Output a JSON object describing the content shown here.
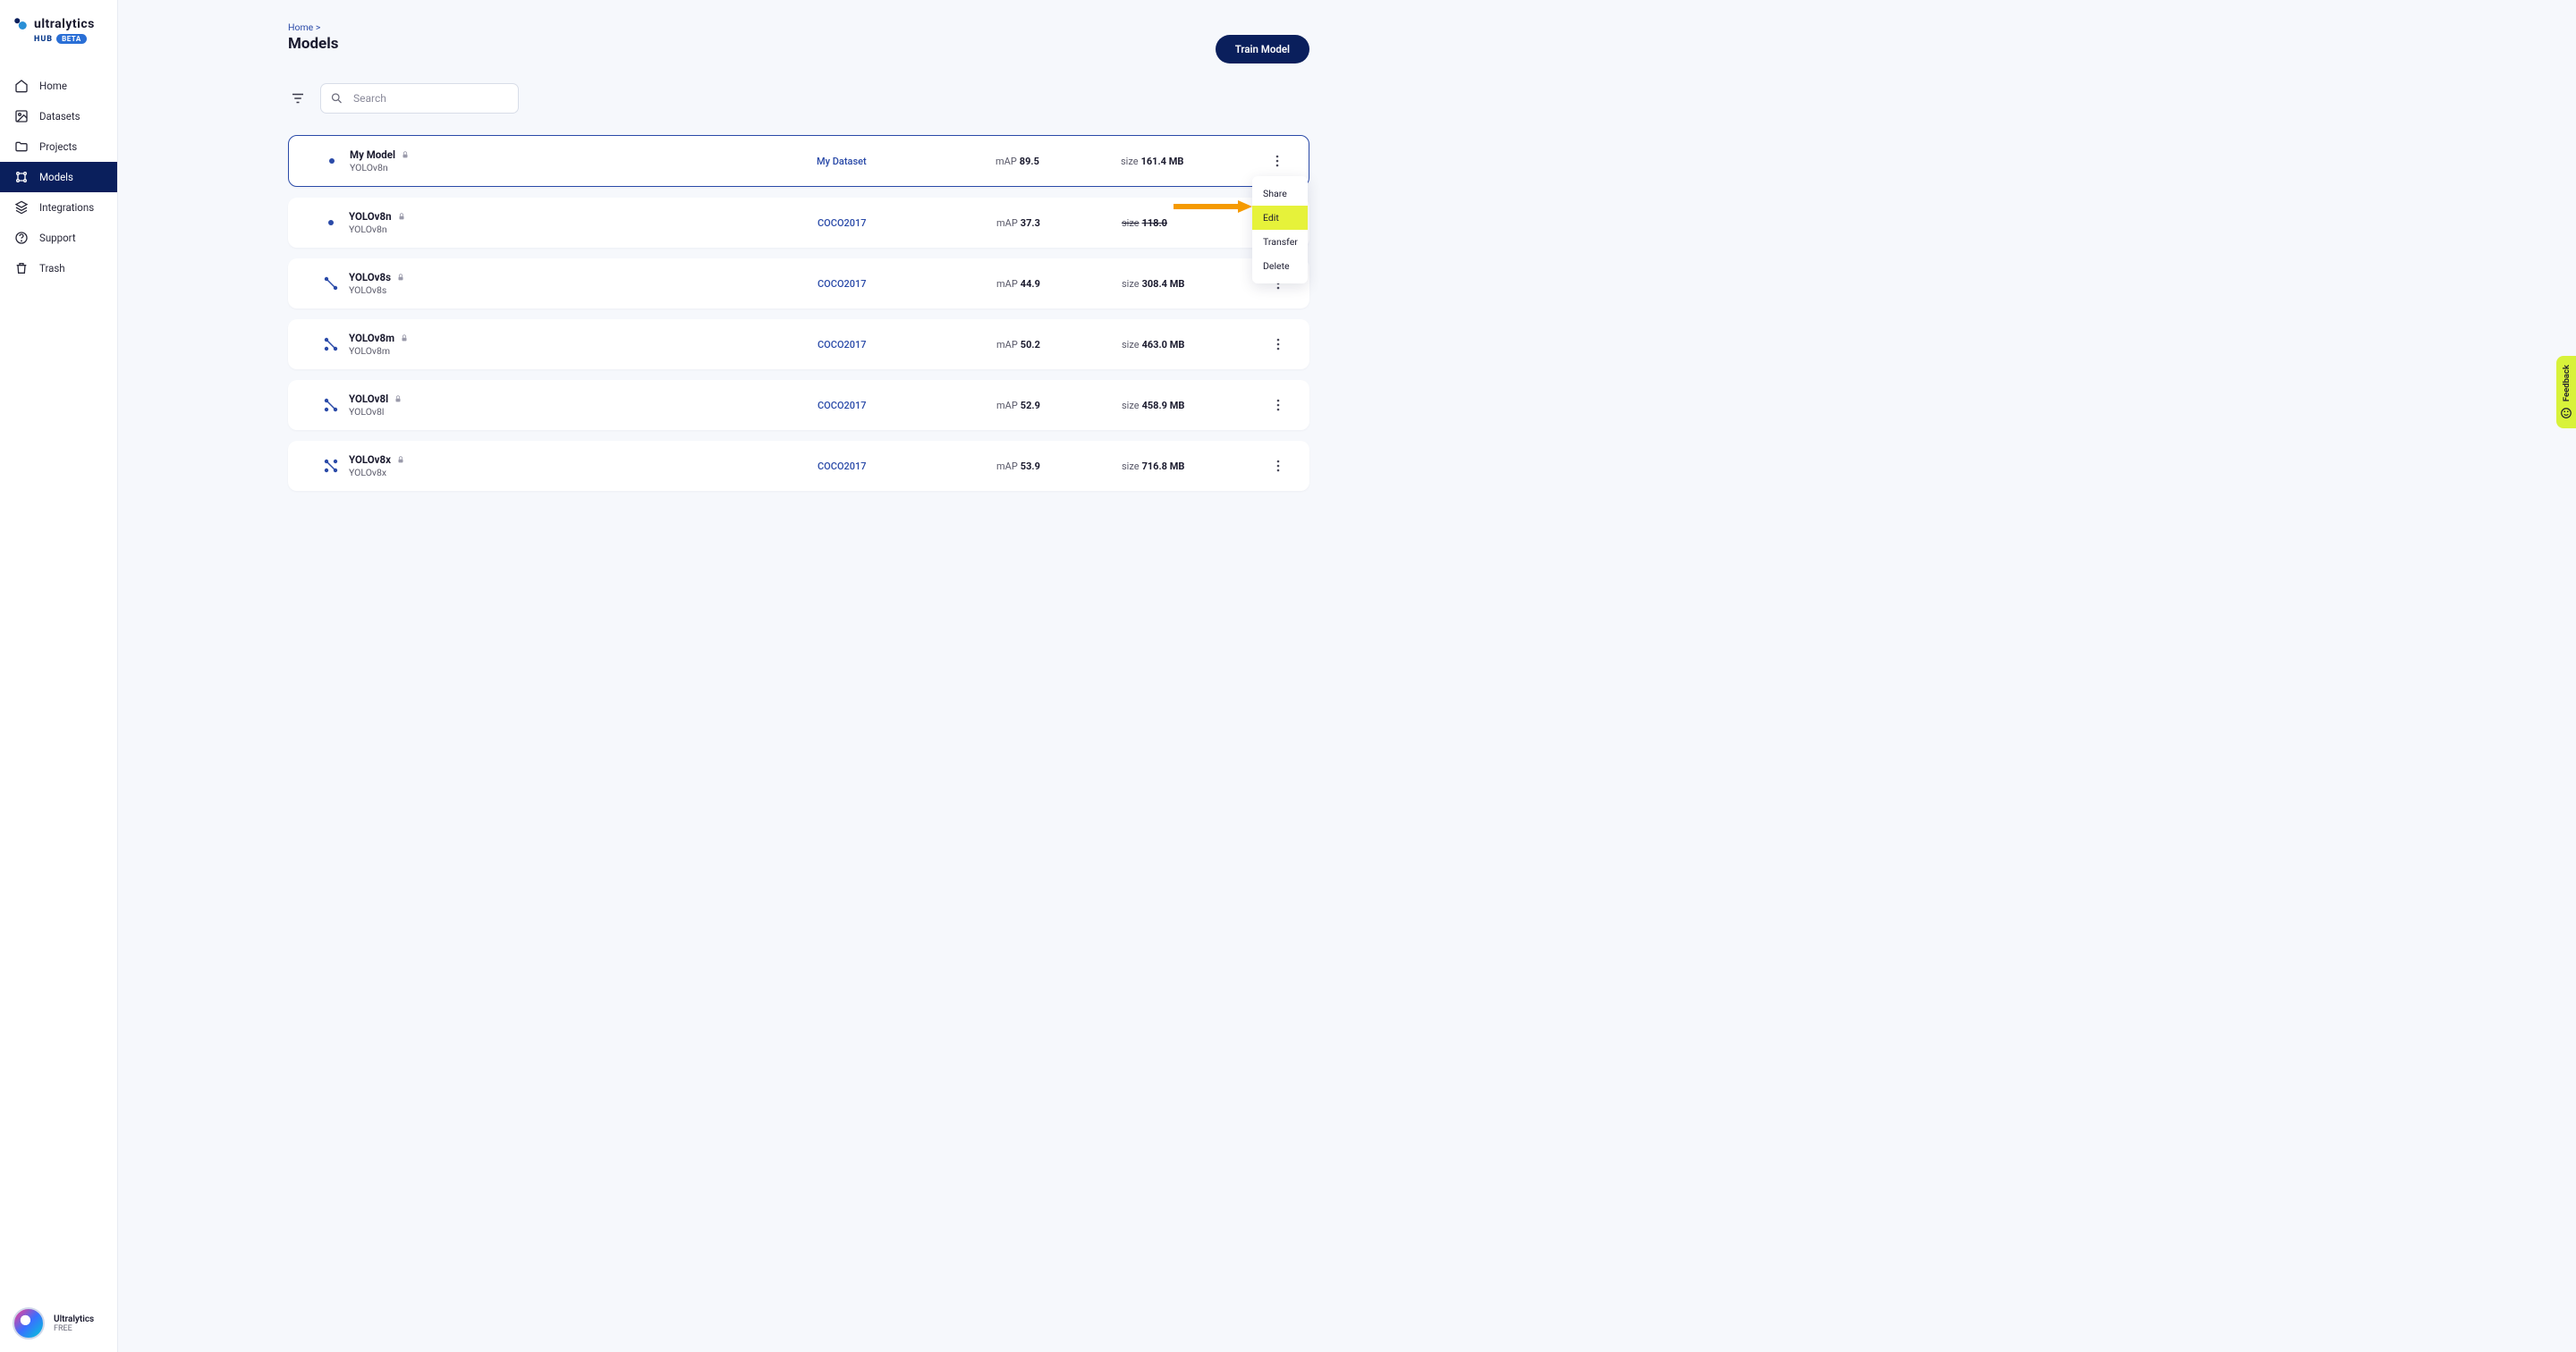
{
  "brand": {
    "name": "ultralytics",
    "hub": "HUB",
    "beta": "BETA"
  },
  "nav": {
    "home": "Home",
    "datasets": "Datasets",
    "projects": "Projects",
    "models": "Models",
    "integrations": "Integrations",
    "support": "Support",
    "trash": "Trash"
  },
  "user": {
    "name": "Ultralytics",
    "plan": "FREE"
  },
  "breadcrumb": {
    "home": "Home",
    "sep": ">"
  },
  "page": {
    "title": "Models"
  },
  "actions": {
    "train": "Train Model"
  },
  "search": {
    "placeholder": "Search"
  },
  "models": [
    {
      "name": "My Model",
      "arch": "YOLOv8n",
      "locked": true,
      "dataset": "My Dataset",
      "map": "89.5",
      "size": "161.4 MB",
      "selected": true,
      "status": "dot"
    },
    {
      "name": "YOLOv8n",
      "arch": "YOLOv8n",
      "locked": true,
      "dataset": "COCO2017",
      "map": "37.3",
      "size": "118.0",
      "status": "dot"
    },
    {
      "name": "YOLOv8s",
      "arch": "YOLOv8s",
      "locked": true,
      "dataset": "COCO2017",
      "map": "44.9",
      "size": "308.4 MB",
      "status": "nodes1"
    },
    {
      "name": "YOLOv8m",
      "arch": "YOLOv8m",
      "locked": true,
      "dataset": "COCO2017",
      "map": "50.2",
      "size": "463.0 MB",
      "status": "nodes2"
    },
    {
      "name": "YOLOv8l",
      "arch": "YOLOv8l",
      "locked": true,
      "dataset": "COCO2017",
      "map": "52.9",
      "size": "458.9 MB",
      "status": "nodes3"
    },
    {
      "name": "YOLOv8x",
      "arch": "YOLOv8x",
      "locked": true,
      "dataset": "COCO2017",
      "map": "53.9",
      "size": "716.8 MB",
      "status": "nodes4"
    }
  ],
  "labels": {
    "map": "mAP",
    "size": "size"
  },
  "dropdown": {
    "share": "Share",
    "edit": "Edit",
    "transfer": "Transfer",
    "delete": "Delete"
  },
  "feedback": "Feedback"
}
